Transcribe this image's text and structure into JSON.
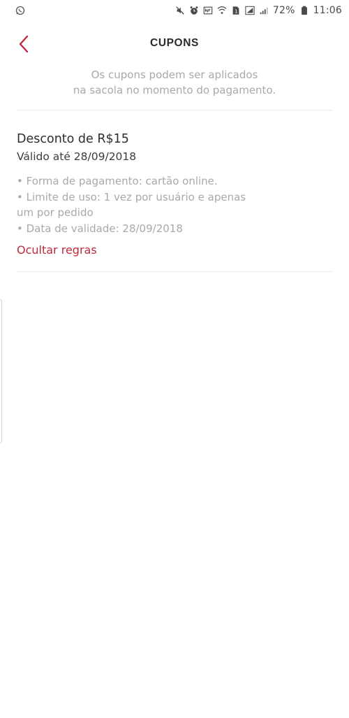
{
  "status_bar": {
    "battery_percent": "72%",
    "clock": "11:06",
    "icons": [
      "whatsapp-icon",
      "mute-icon",
      "alarm-icon",
      "nfc-icon",
      "wifi-icon",
      "sim-icon",
      "signal-icon",
      "signal-icon-2",
      "battery-icon"
    ]
  },
  "header": {
    "title": "CUPONS",
    "back_icon": "chevron-left-icon"
  },
  "info": {
    "line1": "Os cupons podem ser aplicados",
    "line2": "na sacola no momento do pagamento."
  },
  "coupon": {
    "title": "Desconto de R$15",
    "validity": "Válido até 28/09/2018",
    "rules": [
      "• Forma de pagamento: cartão online.",
      "• Limite de uso: 1 vez por usuário e apenas",
      "um por pedido",
      "• Data de validade: 28/09/2018"
    ],
    "toggle_label": "Ocultar regras"
  },
  "colors": {
    "accent": "#c2283e",
    "muted_text": "#a9a9a9",
    "divider": "#ececec"
  }
}
